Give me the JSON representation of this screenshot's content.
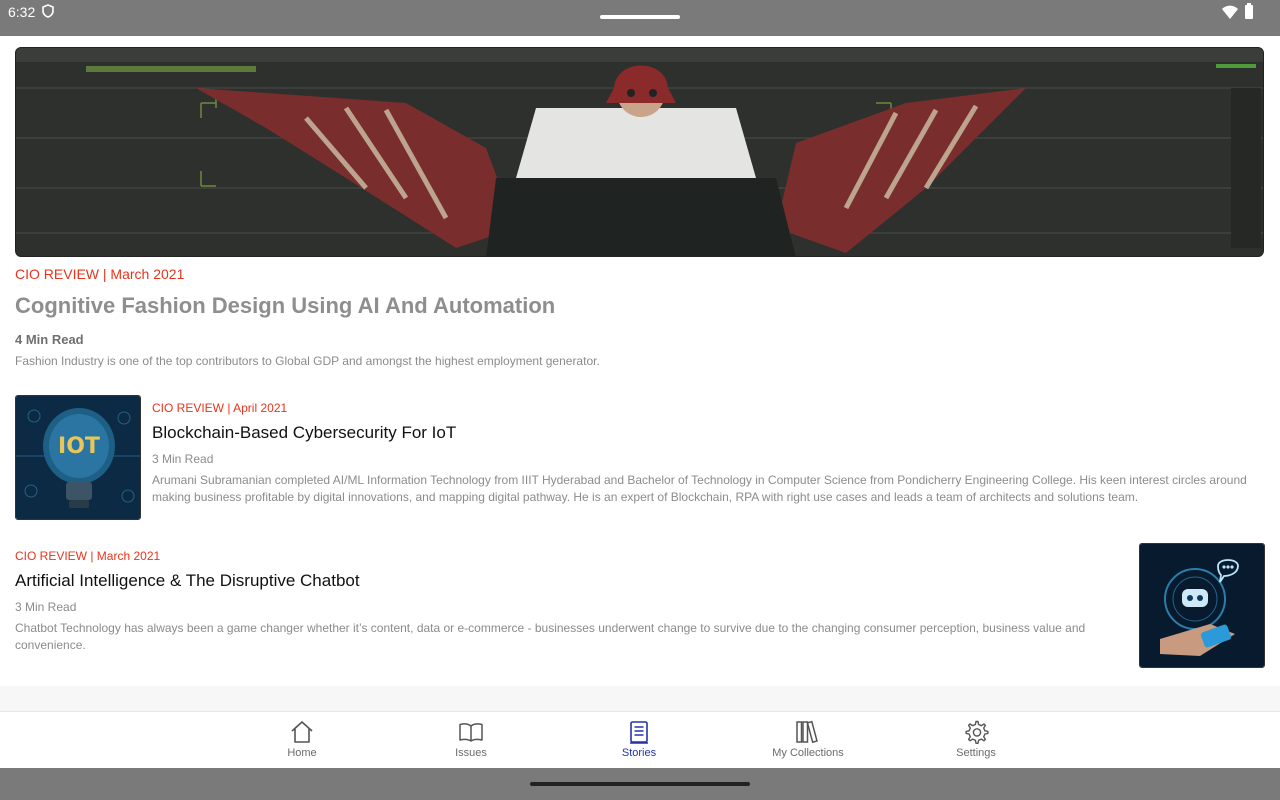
{
  "status": {
    "time": "6:32"
  },
  "featured": {
    "tag": "CIO REVIEW | March 2021",
    "title": "Cognitive Fashion Design Using AI And Automation",
    "read_time": "4 Min Read",
    "description": "Fashion Industry is one of the top contributors to Global GDP and amongst the highest employment generator."
  },
  "stories": [
    {
      "tag": "CIO REVIEW | April 2021",
      "title": "Blockchain-Based Cybersecurity For IoT",
      "read_time": "3 Min Read",
      "description": "Arumani Subramanian completed AI/ML Information Technology from IIIT Hyderabad and Bachelor of Technology in Computer Science from Pondicherry Engineering College. His keen interest circles around making business profitable by digital innovations, and mapping digital pathway. He is an expert of Blockchain, RPA with right use cases and leads a team of architects and solutions team.",
      "thumb_text": "IOT"
    },
    {
      "tag": "CIO REVIEW | March 2021",
      "title": "Artificial Intelligence & The Disruptive Chatbot",
      "read_time": "3 Min Read",
      "description": "Chatbot Technology has always been a game changer whether it’s content, data or e-commerce - businesses underwent change to survive due to the changing consumer perception, business value and convenience."
    }
  ],
  "nav": {
    "items": [
      {
        "label": "Home",
        "icon": "home-icon"
      },
      {
        "label": "Issues",
        "icon": "book-icon"
      },
      {
        "label": "Stories",
        "icon": "document-icon"
      },
      {
        "label": "My Collections",
        "icon": "library-icon"
      },
      {
        "label": "Settings",
        "icon": "gear-icon"
      }
    ],
    "active": "Stories",
    "active_color": "#2233a8"
  },
  "colors": {
    "tag": "#e8341c",
    "bars": "#7a7a7a"
  }
}
